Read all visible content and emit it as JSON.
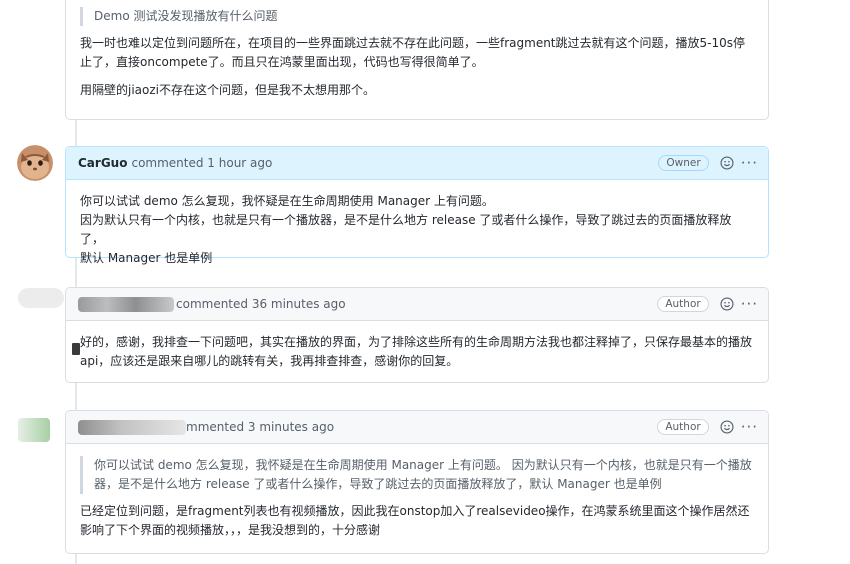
{
  "comments": [
    {
      "quote": "Demo 测试没发现播放有什么问题",
      "paragraphs": [
        "我一时也难以定位到问题所在，在项目的一些界面跳过去就不存在此问题，一些fragment跳过去就有这个问题，播放5-10s停止了，直接oncompete了。而且只在鸿蒙里面出现，代码也写得很简单了。",
        "用隔壁的jiaozi不存在这个问题，但是我不太想用那个。"
      ]
    },
    {
      "author": "CarGuo",
      "meta": "commented 1 hour ago",
      "badge": "Owner",
      "paragraphs": [
        "你可以试试 demo 怎么复现，我怀疑是在生命周期使用 Manager 上有问题。",
        "因为默认只有一个内核，也就是只有一个播放器，是不是什么地方 release 了或者什么操作，导致了跳过去的页面播放释放了，",
        "默认 Manager 也是单例"
      ]
    },
    {
      "meta": "commented 36 minutes ago",
      "badge": "Author",
      "paragraphs": [
        "好的，感谢，我排查一下问题吧，其实在播放的界面，为了排除这些所有的生命周期方法我也都注释掉了，只保存最基本的播放api，应该还是跟来自哪儿的跳转有关，我再排查排查，感谢你的回复。"
      ]
    },
    {
      "meta": "mmented 3 minutes ago",
      "badge": "Author",
      "quote": "你可以试试 demo 怎么复现，我怀疑是在生命周期使用 Manager 上有问题。 因为默认只有一个内核，也就是只有一个播放器，是不是什么地方 release 了或者什么操作，导致了跳过去的页面播放释放了，默认 Manager 也是单例",
      "paragraphs": [
        "已经定位到问题，是fragment列表也有视频播放，因此我在onstop加入了realsevideo操作，在鸿蒙系统里面这个操作居然还影响了下个界面的视频播放，，，是我没想到的，十分感谢"
      ]
    }
  ],
  "icons": {
    "reaction": "smiley-icon",
    "menu": "kebab-horizontal-icon"
  },
  "colors": {
    "owner_header": "#ddf4ff",
    "header": "#f6f8fa",
    "border": "#d8dee4"
  }
}
